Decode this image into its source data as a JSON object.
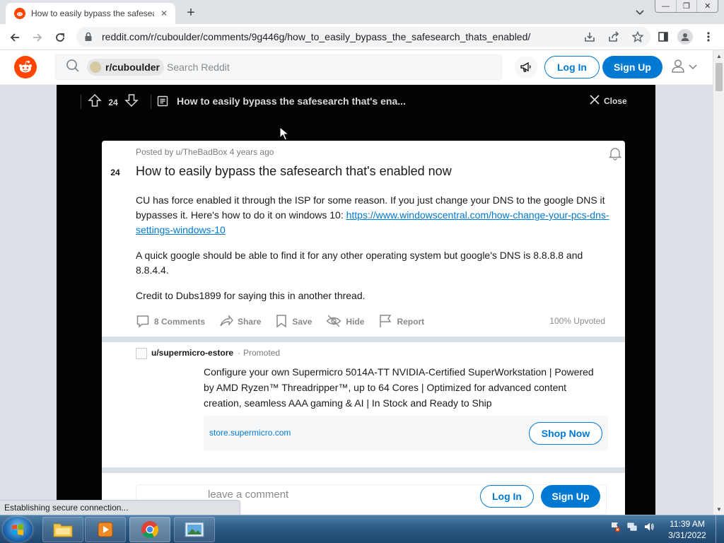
{
  "browser": {
    "tab_title": "How to easily bypass the safesea",
    "url": "reddit.com/r/cuboulder/comments/9g446g/how_to_easily_bypass_the_safesearch_thats_enabled/"
  },
  "header": {
    "community": "r/cuboulder",
    "search_placeholder": "Search Reddit",
    "login_label": "Log In",
    "signup_label": "Sign Up"
  },
  "overlay": {
    "score": "24",
    "title": "How to easily bypass the safesearch that's ena...",
    "close_label": "Close"
  },
  "post": {
    "score": "24",
    "meta": "Posted by u/TheBadBox 4 years ago",
    "title": "How to easily bypass the safesearch that's enabled now",
    "para1_text": "CU has force enabled it through the ISP for some reason. If you just change your DNS to the google DNS it bypasses it. Here's how to do it on windows 10: ",
    "para1_link": "https://www.windowscentral.com/how-change-your-pcs-dns-settings-windows-10",
    "para2": "A quick google should be able to find it for any other operating system but google's DNS is 8.8.8.8 and 8.8.4.4.",
    "para3": "Credit to Dubs1899 for saying this in another thread.",
    "actions": {
      "comments": "8 Comments",
      "share": "Share",
      "save": "Save",
      "hide": "Hide",
      "report": "Report"
    },
    "upvoted": "100% Upvoted"
  },
  "ad": {
    "user": "u/supermicro-estore",
    "dot": "·",
    "promoted": "Promoted",
    "text": "Configure your own Supermicro 5014A-TT NVIDIA-Certified SuperWorkstation | Powered by AMD Ryzen™ Threadripper™, up to 64 Cores | Optimized for advanced content creation, seamless AAA gaming & AI | In Stock and Ready to Ship",
    "domain": "store.supermicro.com",
    "cta": "Shop Now"
  },
  "comment": {
    "placeholder": "leave a comment",
    "login_label": "Log In",
    "signup_label": "Sign Up"
  },
  "status_text": "Establishing secure connection...",
  "taskbar": {
    "time": "11:39 AM",
    "date": "3/31/2022"
  },
  "colors": {
    "reddit_orange": "#ff4500",
    "reddit_blue": "#0079d3",
    "overlay_bg": "#030303"
  }
}
